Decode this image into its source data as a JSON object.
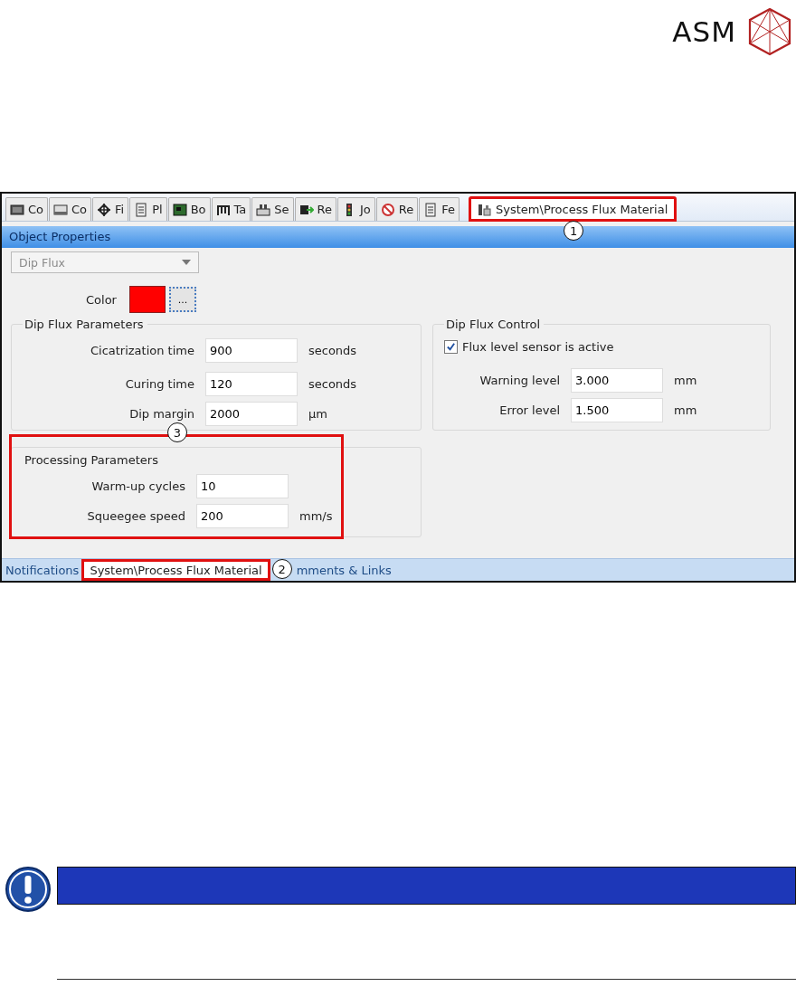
{
  "logo": {
    "text": "ASM"
  },
  "window": {
    "tabs": [
      {
        "label": "Co",
        "selected": false
      },
      {
        "label": "Co",
        "selected": false
      },
      {
        "label": "Fi",
        "selected": false
      },
      {
        "label": "Pl",
        "selected": false
      },
      {
        "label": "Bo",
        "selected": false
      },
      {
        "label": "Ta",
        "selected": false
      },
      {
        "label": "Se",
        "selected": false
      },
      {
        "label": "Re",
        "selected": false
      },
      {
        "label": "Jo",
        "selected": false
      },
      {
        "label": "Re",
        "selected": false
      },
      {
        "label": "Fe",
        "selected": false
      },
      {
        "label": "System\\Process Flux Material",
        "selected": true,
        "callout": "1"
      }
    ],
    "header": "Object Properties",
    "type_select": {
      "value": "Dip Flux",
      "disabled": true
    },
    "color": {
      "label": "Color",
      "color": "#ff0000",
      "button": "..."
    },
    "groups": [
      {
        "title": "Dip Flux Parameters",
        "kind": "fields",
        "rows": [
          {
            "label": "Cicatrization time",
            "value": "900",
            "unit": "seconds"
          },
          {
            "label": "Curing time",
            "value": "120",
            "unit": "seconds"
          },
          {
            "label": "Dip margin",
            "value": "2000",
            "unit": "µm"
          }
        ]
      },
      {
        "title": "Dip Flux Control",
        "kind": "control",
        "checkbox": {
          "label": "Flux level sensor is active",
          "checked": true
        },
        "rows": [
          {
            "label": "Warning level",
            "value": "3.000",
            "unit": "mm"
          },
          {
            "label": "Error level",
            "value": "1.500",
            "unit": "mm"
          }
        ]
      },
      {
        "title": "Processing Parameters",
        "kind": "fields",
        "callout": "3",
        "rows": [
          {
            "label": "Warm-up cycles",
            "value": "10",
            "unit": ""
          },
          {
            "label": "Squeegee speed",
            "value": "200",
            "unit": "mm/s"
          }
        ]
      }
    ],
    "bottom_tabs": [
      {
        "label": "Notifications",
        "selected": false
      },
      {
        "label": "System\\Process Flux Material",
        "selected": true,
        "callout": "2"
      },
      {
        "label": "mments & Links",
        "selected": false
      }
    ]
  }
}
